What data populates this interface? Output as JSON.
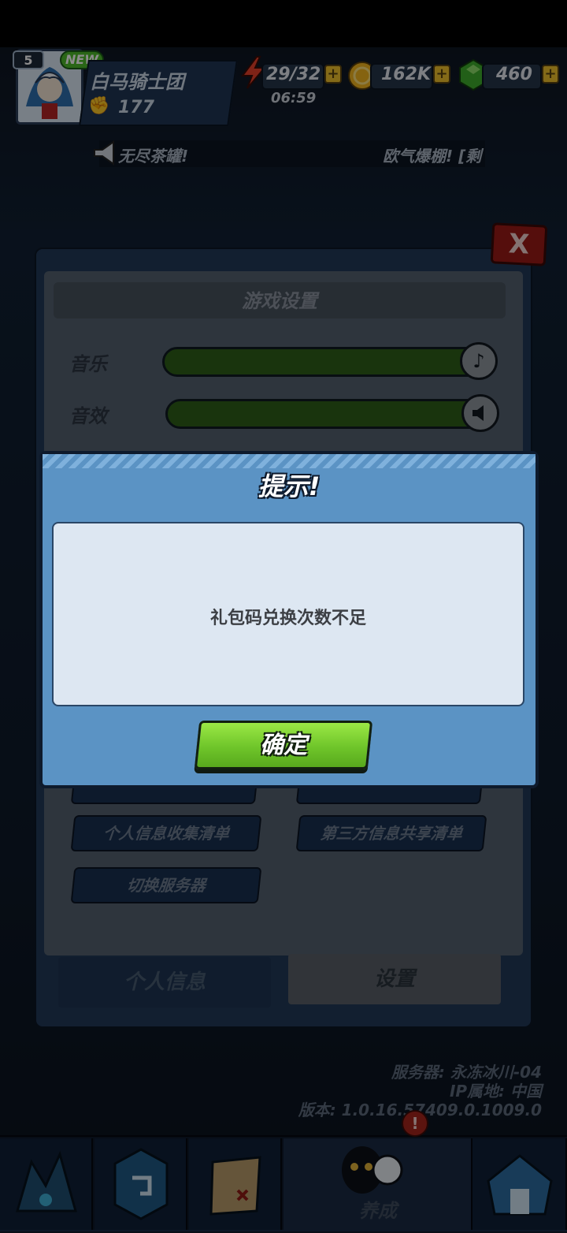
{
  "player": {
    "level": "5",
    "new_badge": "NEW",
    "name": "白马骑士团",
    "power": "177"
  },
  "resources": {
    "energy": "29/32",
    "energy_timer": "06:59",
    "coins": "162K",
    "gems": "460",
    "plus": "+"
  },
  "notice": {
    "left_text": "无尽茶罐!",
    "right_text": "欧气爆棚! [剩"
  },
  "settings_panel": {
    "title": "游戏设置",
    "close_label": "X",
    "music_label": "音乐",
    "sfx_label": "音效",
    "music_level": 1.0,
    "sfx_level": 1.0,
    "buttons": {
      "personal_info_list": "个人信息收集清单",
      "third_party_list": "第三方信息共享清单",
      "switch_server": "切换服务器"
    },
    "tabs": {
      "personal_info": "个人信息",
      "settings": "设置"
    }
  },
  "server_info": {
    "server": "服务器: 永冻冰川-04",
    "ip": "IP属地: 中国",
    "version": "版本: 1.0.16.57409.0.1009.0"
  },
  "bottom_nav": {
    "active_label": "养成",
    "badge": "!"
  },
  "dialog": {
    "title": "提示!",
    "message": "礼包码兑换次数不足",
    "confirm_label": "确定"
  },
  "colors": {
    "dialog_bg": "#5b93c4",
    "confirm_green": "#7fd633",
    "slider_green": "#2f5f18",
    "close_red": "#9c1b16"
  }
}
